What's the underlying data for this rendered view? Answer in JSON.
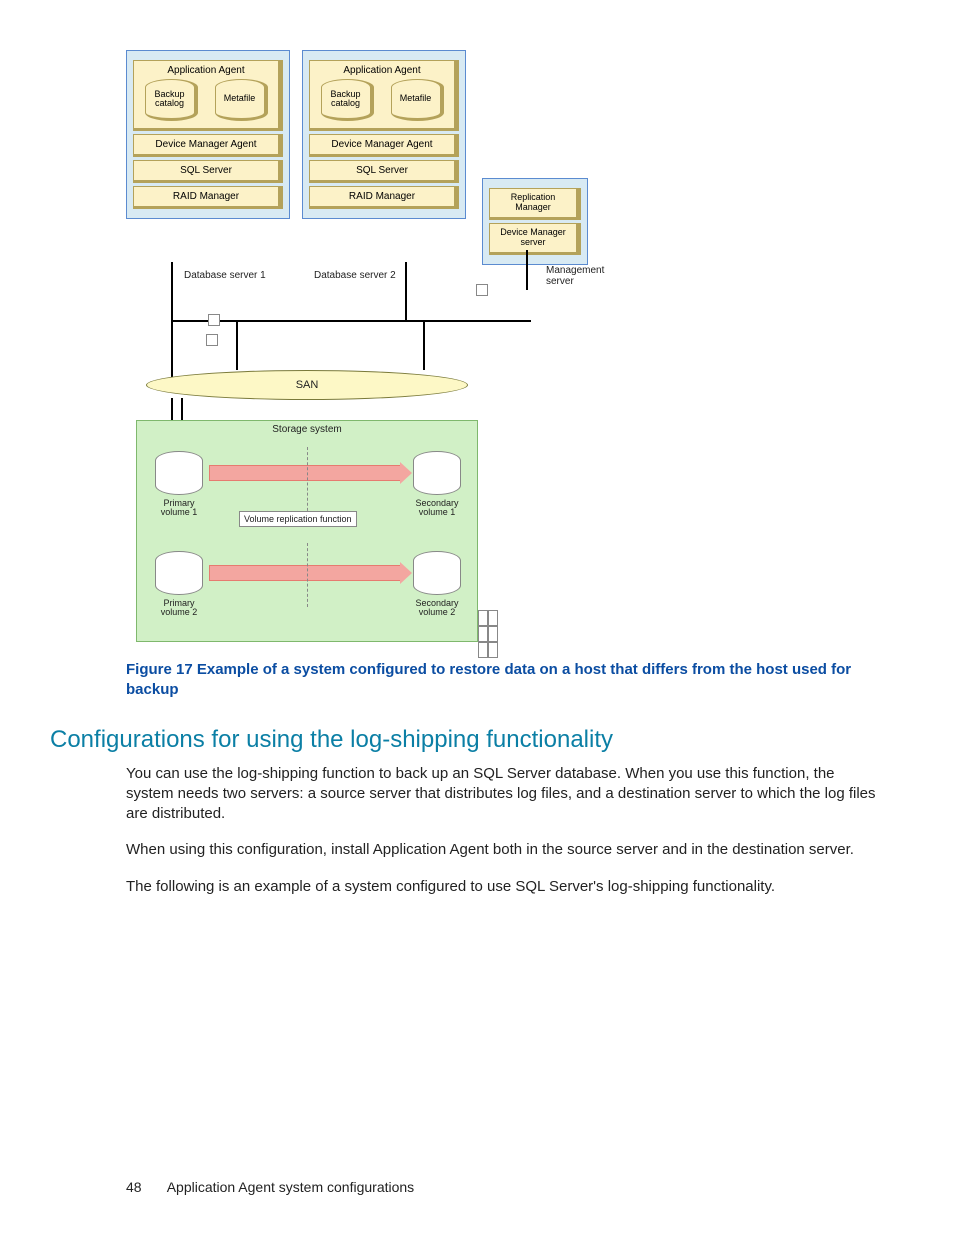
{
  "diagram": {
    "server1": {
      "app_agent": "Application Agent",
      "backup_catalog": "Backup catalog",
      "metafile": "Metafile",
      "dm_agent": "Device Manager Agent",
      "sql": "SQL Server",
      "raid": "RAID Manager",
      "label": "Database server 1"
    },
    "server2": {
      "app_agent": "Application Agent",
      "backup_catalog": "Backup catalog",
      "metafile": "Metafile",
      "dm_agent": "Device Manager Agent",
      "sql": "SQL Server",
      "raid": "RAID Manager",
      "label": "Database server 2"
    },
    "management": {
      "repl_mgr": "Replication Manager",
      "dm_server": "Device Manager server",
      "label": "Management server"
    },
    "san": "SAN",
    "storage": {
      "title": "Storage system",
      "vrf": "Volume replication function",
      "pv1": "Primary volume 1",
      "pv2": "Primary volume 2",
      "sv1": "Secondary volume 1",
      "sv2": "Secondary volume 2"
    }
  },
  "figure_caption": "Figure 17 Example of a system configured to restore data on a host that differs from the host used for backup",
  "section_heading": "Configurations for using the log-shipping functionality",
  "paragraphs": {
    "p1": "You can use the log-shipping function to back up an SQL Server database. When you use this function, the system needs two servers: a source server that distributes log files, and a destination server to which the log files are distributed.",
    "p2": "When using this configuration, install Application Agent both in the source server and in the destination server.",
    "p3": "The following is an example of a system configured to use SQL Server's log-shipping functionality."
  },
  "footer": {
    "page_number": "48",
    "chapter": "Application Agent system configurations"
  }
}
